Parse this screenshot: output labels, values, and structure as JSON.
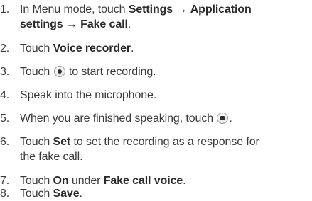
{
  "steps": [
    {
      "number": "1.",
      "line1": {
        "prefix": "In Menu mode, touch ",
        "settings": "Settings",
        "arrow1": " → ",
        "app_settings_a": "Application"
      },
      "line2": {
        "app_settings_b": "settings",
        "arrow2": " → ",
        "fake_call": "Fake call",
        "end": "."
      }
    },
    {
      "number": "2.",
      "prefix": "Touch ",
      "bold": "Voice recorder",
      "end": "."
    },
    {
      "number": "3.",
      "prefix": "Touch ",
      "icon": "record-button-icon",
      "suffix": " to start recording."
    },
    {
      "number": "4.",
      "text": "Speak into the microphone."
    },
    {
      "number": "5.",
      "prefix": "When you are finished speaking, touch ",
      "icon": "stop-button-icon",
      "end": "."
    },
    {
      "number": "6.",
      "prefix": "Touch ",
      "bold": "Set",
      "suffix": " to set the recording as a response for",
      "line2": "the fake call."
    },
    {
      "number": "7.",
      "prefix": "Touch ",
      "bold1": "On",
      "middle": " under ",
      "bold2": "Fake call voice",
      "end": "."
    },
    {
      "number": "8.",
      "prefix": "Touch ",
      "bold": "Save",
      "end": "."
    }
  ]
}
